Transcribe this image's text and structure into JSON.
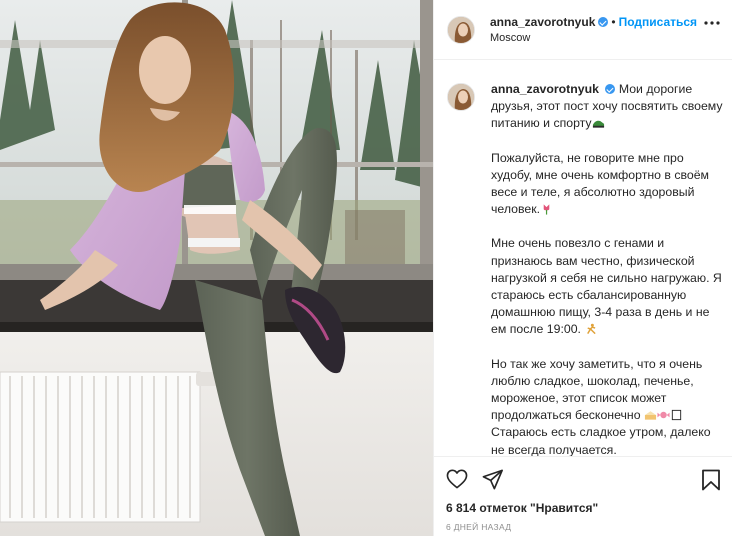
{
  "header": {
    "username": "anna_zavorotnyuk",
    "separator": "•",
    "follow_label": "Подписаться",
    "location": "Moscow"
  },
  "caption": {
    "username": "anna_zavorotnyuk",
    "paragraph1": "Мои дорогие друзья, этот пост хочу посвятить своему питанию и спорту",
    "paragraph2": "Пожалуйста, не говорите мне про худобу, мне очень комфортно в своём весе и теле, я абсолютно здоровый человек.",
    "paragraph3": "Мне очень повезло с генами и признаюсь вам честно, физической нагрузкой я себя не сильно нагружаю. Я стараюсь есть сбалансированную домашнюю пищу, 3-4 раза в день и не ем после 19:00.",
    "paragraph4a": "Но так же хочу заметить, что я очень люблю сладкое, шоколад, печенье, мороженое, этот список может продолжаться бесконечно",
    "paragraph4b": "Стараюсь есть сладкое утром, далеко не всегда получается."
  },
  "actions": {
    "likes_text": "6 814 отметок \"Нравится\"",
    "date_text": "6 дней назад"
  },
  "icons": {
    "like": "heart-icon",
    "share": "paper-plane-icon",
    "save": "bookmark-icon",
    "more": "more-options-icon",
    "verified": "verified-badge-icon"
  },
  "colors": {
    "follow": "#0095f6",
    "verified": "#3897f0",
    "text": "#262626",
    "muted": "#8e8e8e"
  }
}
